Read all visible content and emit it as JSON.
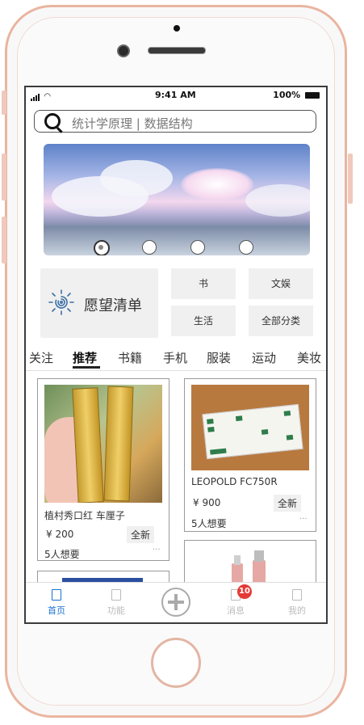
{
  "status_bar": {
    "time": "9:41 AM",
    "battery": "100%"
  },
  "search": {
    "placeholder": "统计学原理 | 数据结构"
  },
  "banner": {
    "slide_count": 4,
    "active_index": 0
  },
  "wishlist": {
    "label": "愿望清单"
  },
  "categories": [
    "书",
    "文娱",
    "生活",
    "全部分类"
  ],
  "tabs": [
    {
      "label": "关注",
      "active": false
    },
    {
      "label": "推荐",
      "active": true
    },
    {
      "label": "书籍",
      "active": false
    },
    {
      "label": "手机",
      "active": false
    },
    {
      "label": "服装",
      "active": false
    },
    {
      "label": "运动",
      "active": false
    },
    {
      "label": "美妆",
      "active": false
    }
  ],
  "products": [
    {
      "title": "植村秀口红 车厘子",
      "price": "¥ 200",
      "condition": "全新",
      "wants": "5人想要",
      "more": "···"
    },
    {
      "title": "LEOPOLD FC750R",
      "price": "¥ 900",
      "condition": "全新",
      "wants": "5人想要",
      "more": "···"
    }
  ],
  "bottom_nav": {
    "home": "首页",
    "features": "功能",
    "messages": "消息",
    "messages_badge": "10",
    "profile": "我的"
  },
  "colors": {
    "accent": "#1a6fd1",
    "badge": "#e53935",
    "frame": "#e9b5a0"
  }
}
